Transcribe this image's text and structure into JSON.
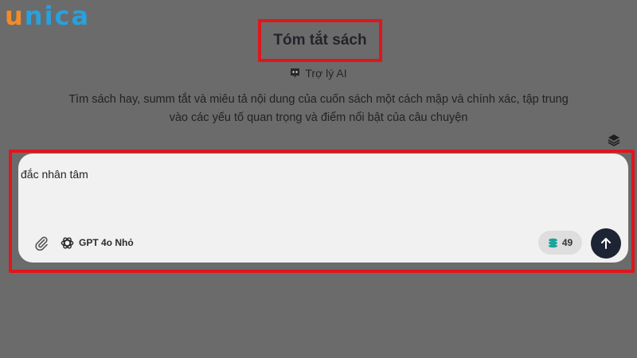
{
  "logo": {
    "first": "u",
    "rest": "nica"
  },
  "header": {
    "title": "Tóm tắt sách",
    "assistant_label": "Trợ lý AI"
  },
  "description": {
    "line1": "Tìm sách hay, summ tắt và miêu tả nội dung của cuốn sách một cách mập và chính xác, tập trung",
    "line2": "vào các yếu tố quan trọng và điểm nổi bật của câu chuyện"
  },
  "composer": {
    "input_value": "đắc nhân tâm",
    "model_label": "GPT 4o Nhỏ",
    "credits": "49"
  },
  "icons": {
    "assistant": "robot-badge-icon",
    "layers": "layers-icon",
    "attach": "paperclip-icon",
    "model": "openai-icon",
    "credits": "coins-icon",
    "send": "arrow-up-icon"
  },
  "colors": {
    "background": "#6b6b6b",
    "highlight": "#e0161d",
    "send_button": "#1d2433",
    "logo_orange": "#f28c28",
    "logo_blue": "#2aa0dc",
    "coin": "#1ba39c"
  }
}
